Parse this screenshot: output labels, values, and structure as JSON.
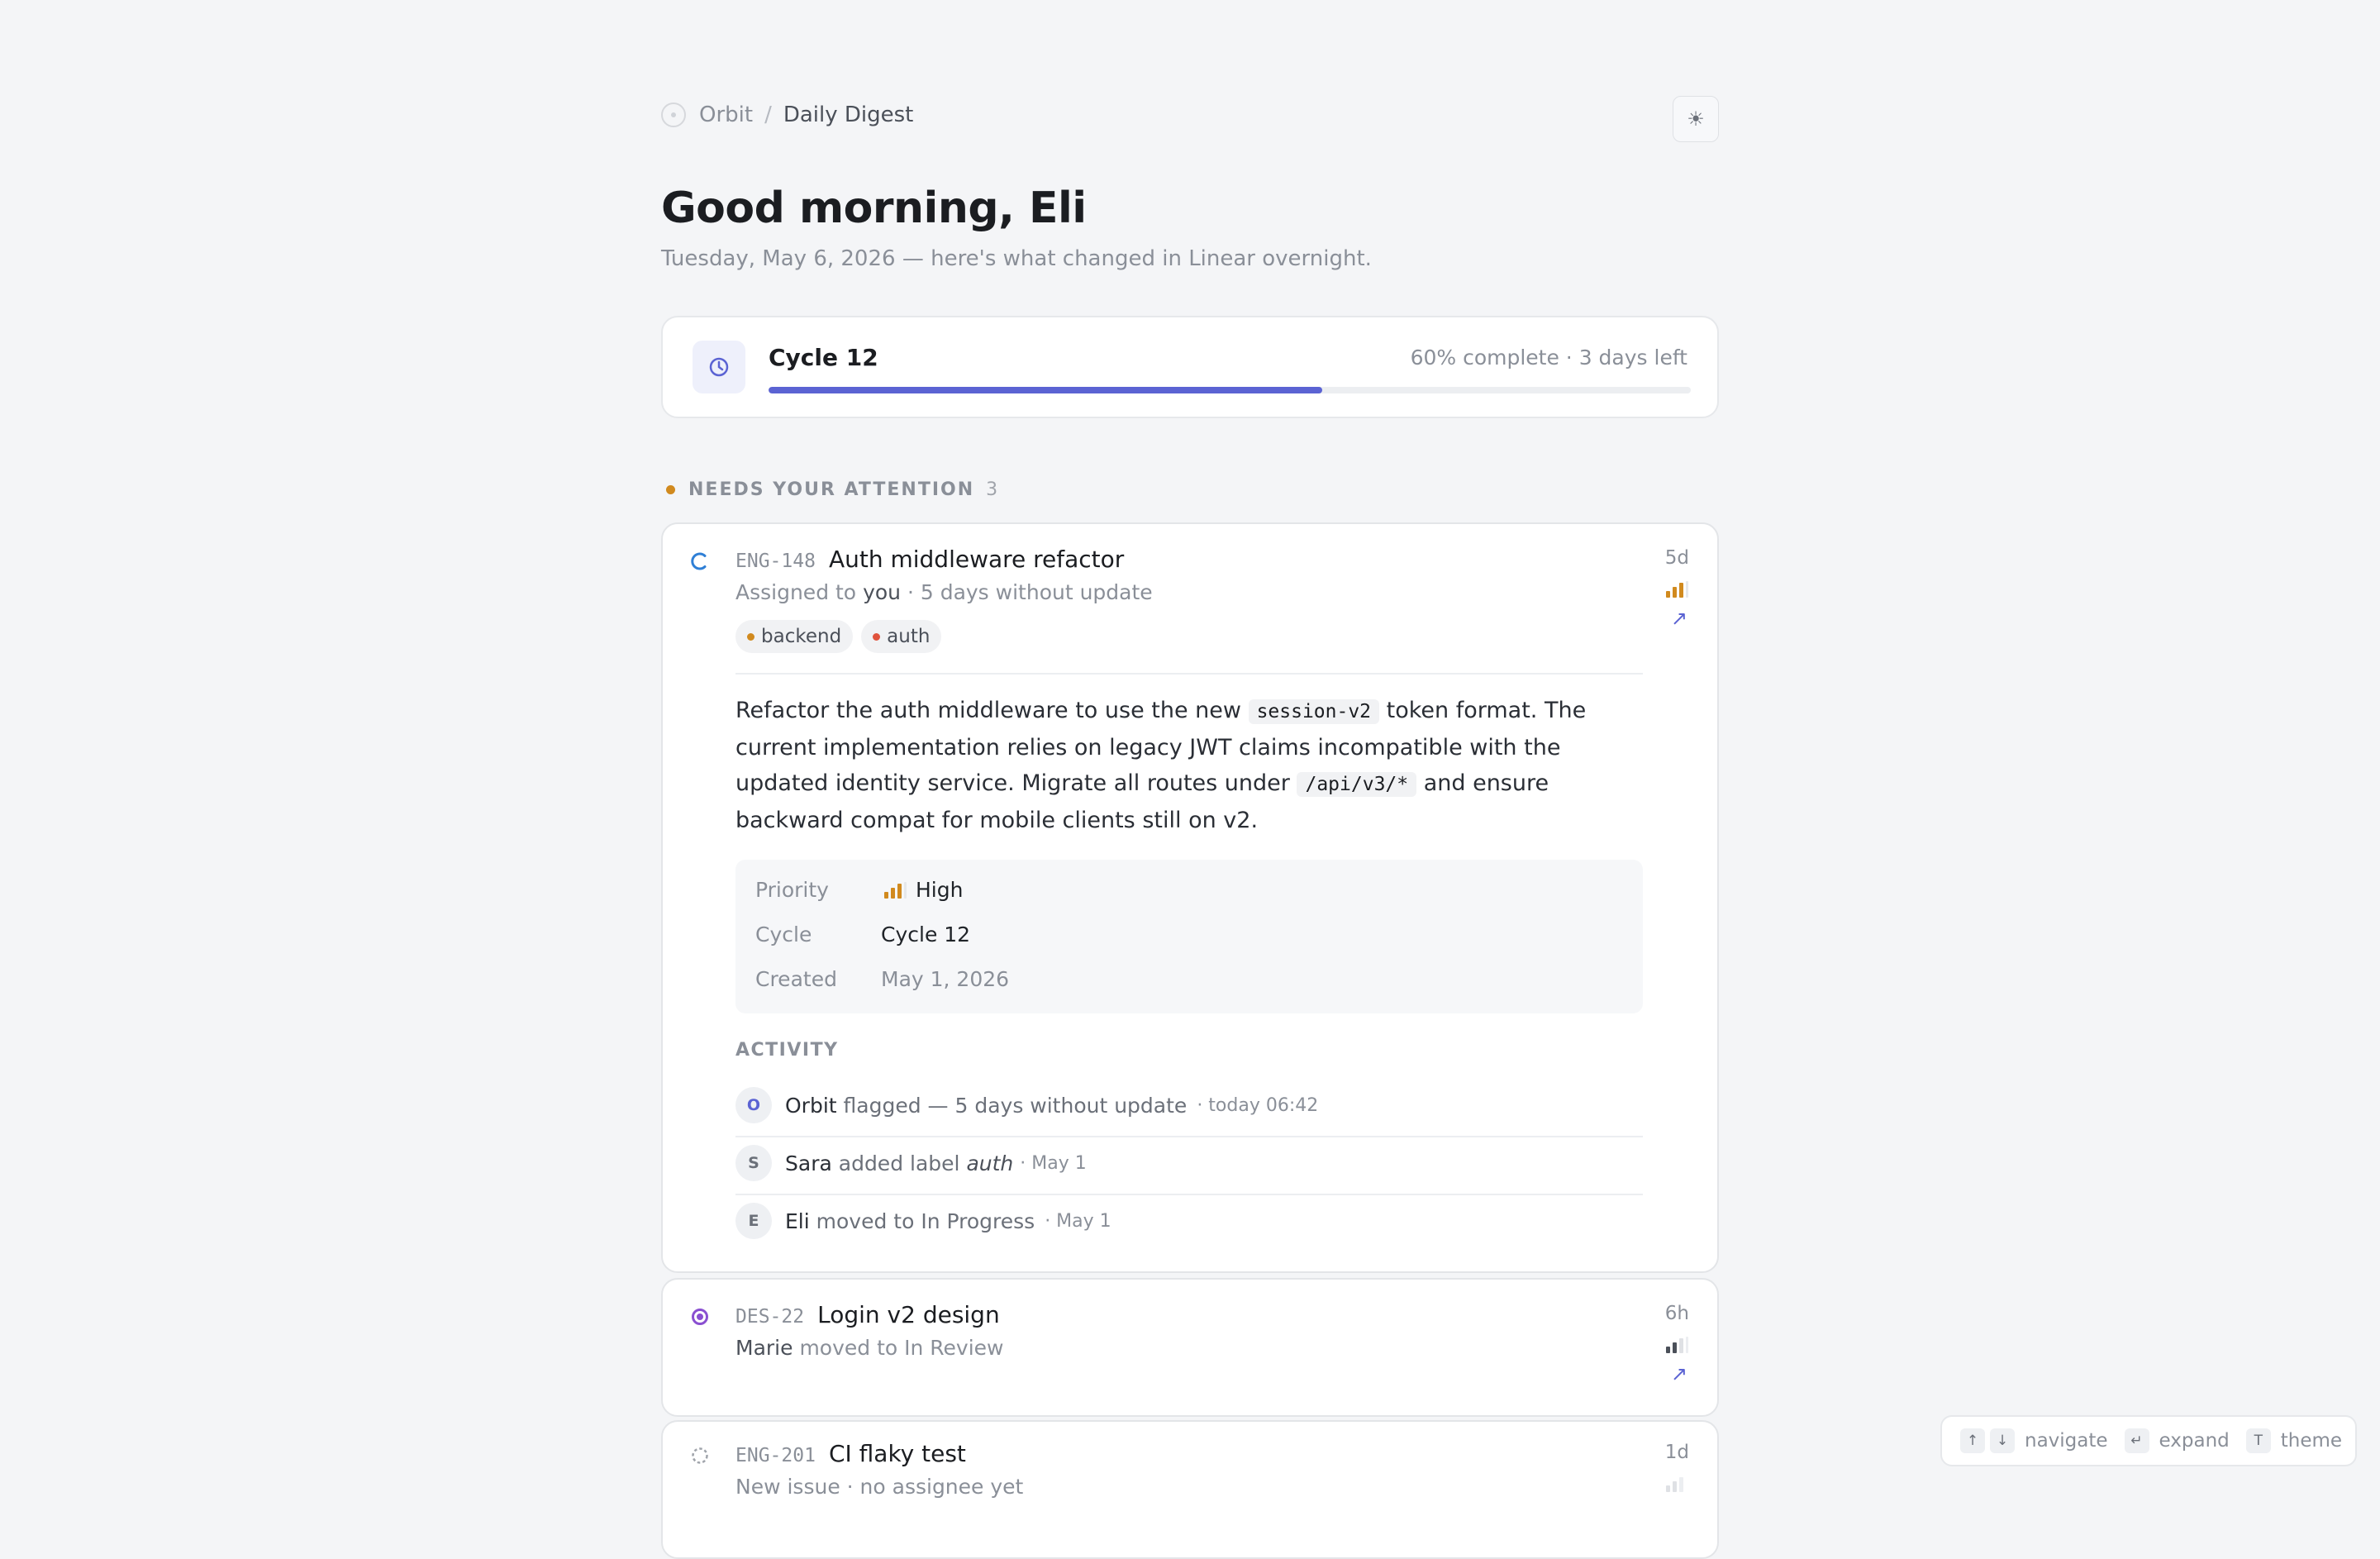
{
  "breadcrumb": {
    "root": "Orbit",
    "separator": "/",
    "current": "Daily Digest"
  },
  "theme_toggle": {
    "icon": "sun-icon",
    "glyph": "☀"
  },
  "greeting": "Good morning, Eli",
  "subtitle": "Tuesday, May 6, 2026 — here's what changed in Linear overnight.",
  "cycle": {
    "name": "Cycle 12",
    "meta": "60% complete · 3 days left",
    "progress": 0.6
  },
  "section": {
    "title": "NEEDS YOUR ATTENTION",
    "count": "3"
  },
  "issues": [
    {
      "id": "ENG-148",
      "title": "Auth middleware refactor",
      "sub_prefix": "Assigned to",
      "sub_user": "you",
      "sub_suffix": "· 5 days without update",
      "age": "5d",
      "priority": "high",
      "status": "in-progress",
      "labels": [
        {
          "name": "backend",
          "color": "#d18a1e"
        },
        {
          "name": "auth",
          "color": "#e0533d"
        }
      ],
      "description": {
        "part1": "Refactor the auth middleware to use the new",
        "code1": "session-v2",
        "part2": "token format. The current implementation relies on legacy JWT claims incompatible with the updated identity service. Migrate all routes under",
        "code2": "/api/v3/*",
        "part3": "and ensure backward compat for mobile clients still on v2."
      },
      "properties": {
        "priority_label": "Priority",
        "priority_value": "High",
        "cycle_label": "Cycle",
        "cycle_value": "Cycle 12",
        "created_label": "Created",
        "created_value": "May 1, 2026"
      },
      "activity_title": "ACTIVITY",
      "activity": [
        {
          "avatar": "O",
          "who": "Orbit",
          "action": "flagged — 5 days without update",
          "time": "· today 06:42"
        },
        {
          "avatar": "S",
          "who": "Sara",
          "action": "added label",
          "emph": "auth",
          "time": "· May 1"
        },
        {
          "avatar": "E",
          "who": "Eli",
          "action": "moved to In Progress",
          "time": "· May 1"
        }
      ]
    },
    {
      "id": "DES-22",
      "title": "Login v2 design",
      "sub_user": "Marie",
      "sub_suffix": "moved to In Review",
      "age": "6h",
      "priority": "medium",
      "status": "in-review"
    },
    {
      "id": "ENG-201",
      "title": "CI flaky test",
      "sub_prefix": "New issue · no assignee yet",
      "age": "1d",
      "priority": "low",
      "status": "backlog"
    }
  ],
  "open_icon": "↗",
  "hints": [
    {
      "keys": [
        "↑",
        "↓"
      ],
      "label": "navigate"
    },
    {
      "keys": [
        "↵"
      ],
      "label": "expand"
    },
    {
      "keys": [
        "T"
      ],
      "label": "theme"
    }
  ],
  "colors": {
    "accent": "#5b63d3",
    "high_priority": "#d18a1e",
    "in_progress": "#2f7fd6",
    "in_review": "#8a4fd1"
  }
}
